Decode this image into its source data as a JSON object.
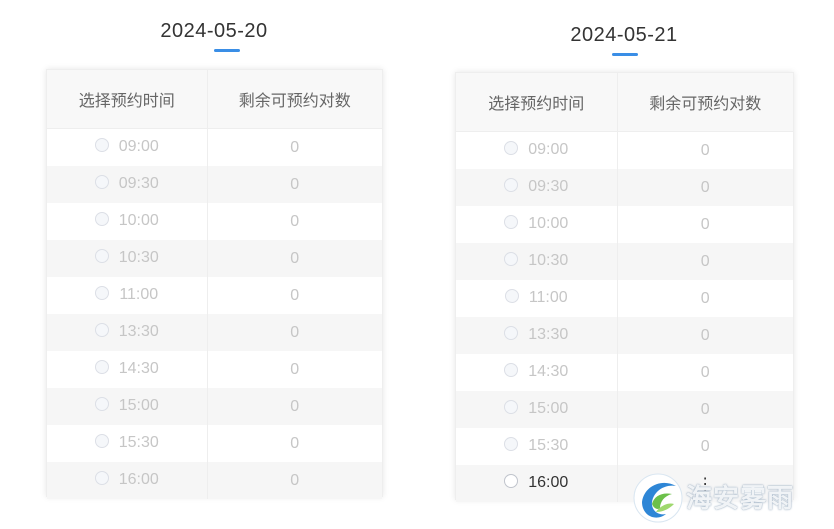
{
  "columns": {
    "time": "选择预约时间",
    "remaining": "剩余可预约对数"
  },
  "days": [
    {
      "date": "2024-05-20",
      "slots": [
        {
          "time": "09:00",
          "remaining": "0"
        },
        {
          "time": "09:30",
          "remaining": "0"
        },
        {
          "time": "10:00",
          "remaining": "0"
        },
        {
          "time": "10:30",
          "remaining": "0"
        },
        {
          "time": "11:00",
          "remaining": "0"
        },
        {
          "time": "13:30",
          "remaining": "0"
        },
        {
          "time": "14:30",
          "remaining": "0"
        },
        {
          "time": "15:00",
          "remaining": "0"
        },
        {
          "time": "15:30",
          "remaining": "0"
        },
        {
          "time": "16:00",
          "remaining": "0"
        }
      ]
    },
    {
      "date": "2024-05-21",
      "slots": [
        {
          "time": "09:00",
          "remaining": "0"
        },
        {
          "time": "09:30",
          "remaining": "0"
        },
        {
          "time": "10:00",
          "remaining": "0"
        },
        {
          "time": "10:30",
          "remaining": "0"
        },
        {
          "time": "11:00",
          "remaining": "0"
        },
        {
          "time": "13:30",
          "remaining": "0"
        },
        {
          "time": "14:30",
          "remaining": "0"
        },
        {
          "time": "15:00",
          "remaining": "0"
        },
        {
          "time": "15:30",
          "remaining": "0"
        },
        {
          "time": "16:00",
          "remaining": "⋮"
        }
      ]
    }
  ],
  "watermark": {
    "text": "海安雾雨",
    "icon": "watermark-logo-icon"
  },
  "colors": {
    "accent": "#3a8ee6",
    "disabled_text": "#c6c6c6",
    "enabled_text": "#333333"
  }
}
